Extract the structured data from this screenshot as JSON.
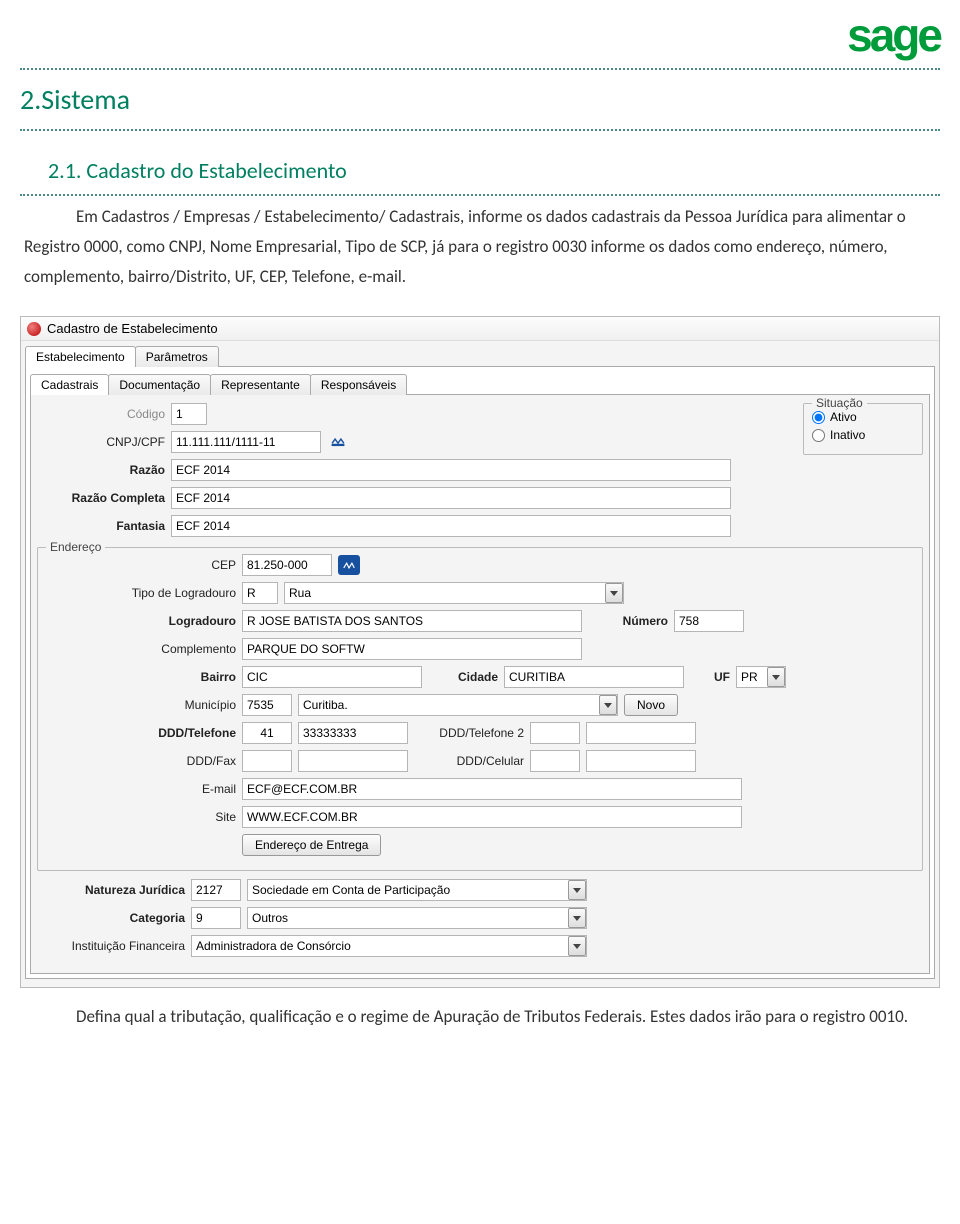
{
  "logo_text": "sage",
  "doc": {
    "h1": "2.Sistema",
    "h2": "2.1.    Cadastro do Estabelecimento",
    "p1": "Em Cadastros / Empresas / Estabelecimento/ Cadastrais, informe os dados cadastrais da Pessoa Jurídica para alimentar o Registro 0000, como CNPJ, Nome Empresarial, Tipo de SCP, já para o registro 0030 informe os dados como endereço, número, complemento, bairro/Distrito, UF, CEP, Telefone, e-mail.",
    "foot": "Defina qual a tributação, qualificação e o regime de Apuração de Tributos Federais. Estes dados irão para o registro 0010."
  },
  "window_title": "Cadastro de Estabelecimento",
  "outer_tabs": [
    "Estabelecimento",
    "Parâmetros"
  ],
  "inner_tabs": [
    "Cadastrais",
    "Documentação",
    "Representante",
    "Responsáveis"
  ],
  "labels": {
    "codigo": "Código",
    "cnpj": "CNPJ/CPF",
    "razao": "Razão",
    "razao_completa": "Razão Completa",
    "fantasia": "Fantasia",
    "situacao": "Situação",
    "ativo": "Ativo",
    "inativo": "Inativo",
    "endereco": "Endereço",
    "cep": "CEP",
    "tipo_logradouro": "Tipo de Logradouro",
    "logradouro": "Logradouro",
    "numero": "Número",
    "complemento": "Complemento",
    "bairro": "Bairro",
    "cidade": "Cidade",
    "uf": "UF",
    "municipio": "Município",
    "novo": "Novo",
    "ddd_tel": "DDD/Telefone",
    "ddd_tel2": "DDD/Telefone 2",
    "ddd_fax": "DDD/Fax",
    "ddd_cel": "DDD/Celular",
    "email": "E-mail",
    "site": "Site",
    "endereco_entrega": "Endereço de Entrega",
    "nat_jur": "Natureza Jurídica",
    "categoria": "Categoria",
    "inst_fin": "Instituição Financeira"
  },
  "values": {
    "codigo": "1",
    "cnpj": "11.111.111/1111-11",
    "razao": "ECF 2014",
    "razao_completa": "ECF 2014",
    "fantasia": "ECF 2014",
    "cep": "81.250-000",
    "tipo_log_code": "R",
    "tipo_log_desc": "Rua",
    "logradouro": "R JOSE BATISTA DOS SANTOS",
    "numero": "758",
    "complemento": "PARQUE DO SOFTW",
    "bairro": "CIC",
    "cidade": "CURITIBA",
    "uf": "PR",
    "municipio_code": "7535",
    "municipio_desc": "Curitiba.",
    "ddd": "41",
    "telefone": "33333333",
    "ddd2": "",
    "telefone2": "",
    "ddd_fax": "",
    "fax": "",
    "ddd_cel": "",
    "celular": "",
    "email": "ECF@ECF.COM.BR",
    "site": "WWW.ECF.COM.BR",
    "nat_jur_code": "2127",
    "nat_jur_desc": "Sociedade em Conta de Participação",
    "categoria_code": "9",
    "categoria_desc": "Outros",
    "inst_fin": "Administradora de Consórcio"
  }
}
